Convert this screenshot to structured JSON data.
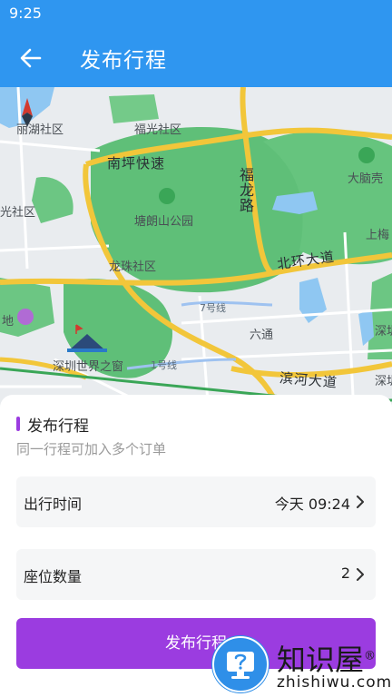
{
  "status": {
    "time": "9:25"
  },
  "appbar": {
    "title": "发布行程",
    "back_icon": "arrow-left-icon"
  },
  "map": {
    "labels": {
      "lihu": "丽湖社区",
      "fuguang": "福光社区",
      "nanping": "南坪快速",
      "danao": "大脑壳",
      "guang": "光社区",
      "tanglang": "塘朗山公园",
      "fulong": "福龙路",
      "shanghe": "上梅",
      "longzhu": "龙珠社区",
      "beihuan": "北环大道",
      "line7": "7号线",
      "di": "地",
      "liutong": "六通",
      "shen1": "深圳",
      "window": "深圳世界之窗",
      "line1": "1号线",
      "binhe": "滨河大道",
      "shen2": "深圳"
    }
  },
  "sheet": {
    "title": "发布行程",
    "subtitle": "同一行程可加入多个订单",
    "time_row": {
      "label": "出行时间",
      "value": "今天 09:24"
    },
    "seat_row": {
      "label": "座位数量",
      "value": "2"
    },
    "publish_label": "发布行程"
  },
  "watermark": {
    "title": "知识屋",
    "mark": "®",
    "url": "zhishiwu.com"
  },
  "colors": {
    "appbar": "#2f96f0",
    "accent": "#9b3ce0",
    "park": "#5fbf78",
    "road": "#f2c63a"
  }
}
